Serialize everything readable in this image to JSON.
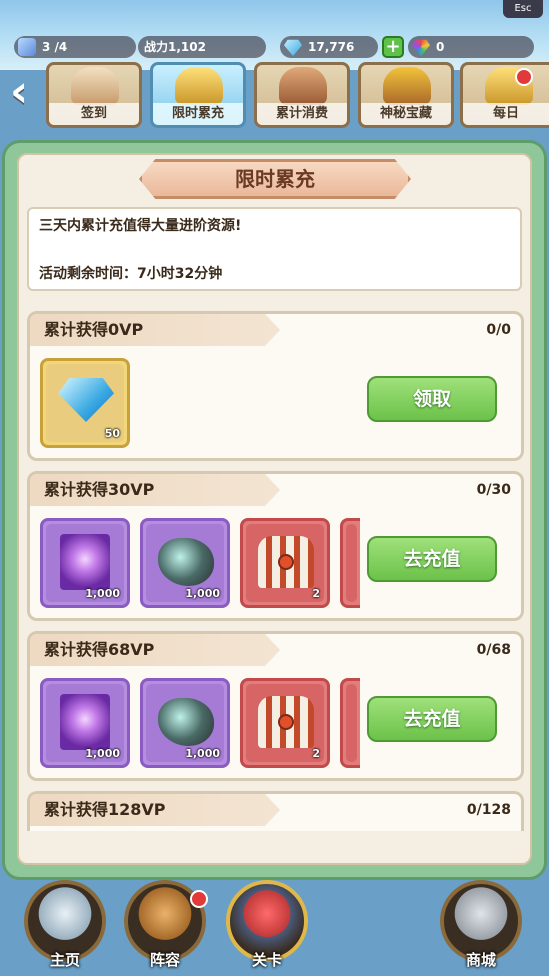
{
  "esc_label": "Esc",
  "topbar": {
    "stamina": "3 /4",
    "power": "战力1,102",
    "diamonds": "17,776",
    "gems": "0"
  },
  "tabs": [
    {
      "label": "签到"
    },
    {
      "label": "限时累充",
      "active": true
    },
    {
      "label": "累计消费"
    },
    {
      "label": "神秘宝藏"
    },
    {
      "label": "每日"
    }
  ],
  "panel": {
    "title": "限时累充",
    "description": "三天内累计充值得大量进阶资源!",
    "time_remaining": "活动剩余时间：7小时32分钟"
  },
  "rewards": [
    {
      "title": "累计获得0VP",
      "progress": "0/0",
      "button": "领取",
      "items": [
        {
          "icon": "diamond-icon",
          "count": "50",
          "frame": "gold"
        }
      ]
    },
    {
      "title": "累计获得30VP",
      "progress": "0/30",
      "button": "去充值",
      "items": [
        {
          "icon": "spellbook-icon",
          "count": "1,000",
          "frame": "purple"
        },
        {
          "icon": "ore-stone-icon",
          "count": "1,000",
          "frame": "purple"
        },
        {
          "icon": "treasure-chest-icon",
          "count": "2",
          "frame": "red"
        }
      ]
    },
    {
      "title": "累计获得68VP",
      "progress": "0/68",
      "button": "去充值",
      "items": [
        {
          "icon": "spellbook-icon",
          "count": "1,000",
          "frame": "purple"
        },
        {
          "icon": "ore-stone-icon",
          "count": "1,000",
          "frame": "purple"
        },
        {
          "icon": "treasure-chest-icon",
          "count": "2",
          "frame": "red"
        }
      ]
    },
    {
      "title": "累计获得128VP",
      "progress": "0/128"
    }
  ],
  "nav": [
    {
      "label": "主页",
      "icon": "castle-icon"
    },
    {
      "label": "阵容",
      "icon": "helmet-icon"
    },
    {
      "label": "关卡",
      "icon": "battle-tower-icon"
    },
    {
      "label": "商城",
      "icon": "gachapon-icon"
    }
  ],
  "colors": {
    "panel_green": "#8fc79a",
    "button_green": "#6cc24a",
    "accent_red": "#e23a3a"
  }
}
